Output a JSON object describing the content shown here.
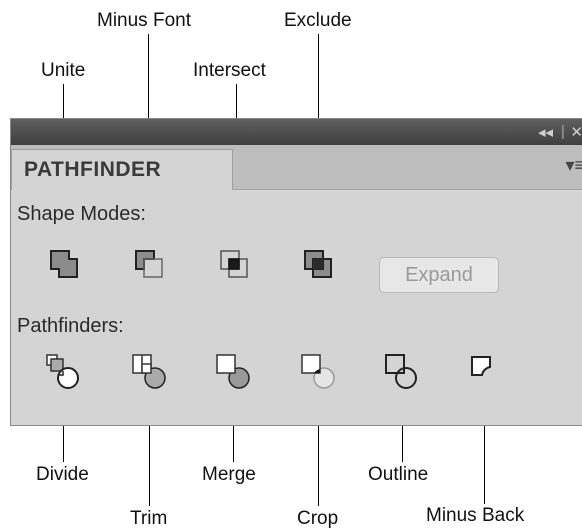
{
  "callouts": {
    "unite": "Unite",
    "minus_front": "Minus Font",
    "intersect": "Intersect",
    "exclude": "Exclude",
    "divide": "Divide",
    "trim": "Trim",
    "merge": "Merge",
    "crop": "Crop",
    "outline": "Outline",
    "minus_back": "Minus Back"
  },
  "panel": {
    "tab_title": "PATHFINDER",
    "collapse_glyph": "◂◂",
    "close_glyph": "✕",
    "menu_glyph": "▾≡",
    "shape_modes_label": "Shape Modes:",
    "expand_label": "Expand",
    "pathfinders_label": "Pathfinders:"
  },
  "icons": {
    "shape_modes": [
      "unite-icon",
      "minus-front-icon",
      "intersect-icon",
      "exclude-icon"
    ],
    "pathfinders": [
      "divide-icon",
      "trim-icon",
      "merge-icon",
      "crop-icon",
      "outline-icon",
      "minus-back-icon"
    ]
  }
}
